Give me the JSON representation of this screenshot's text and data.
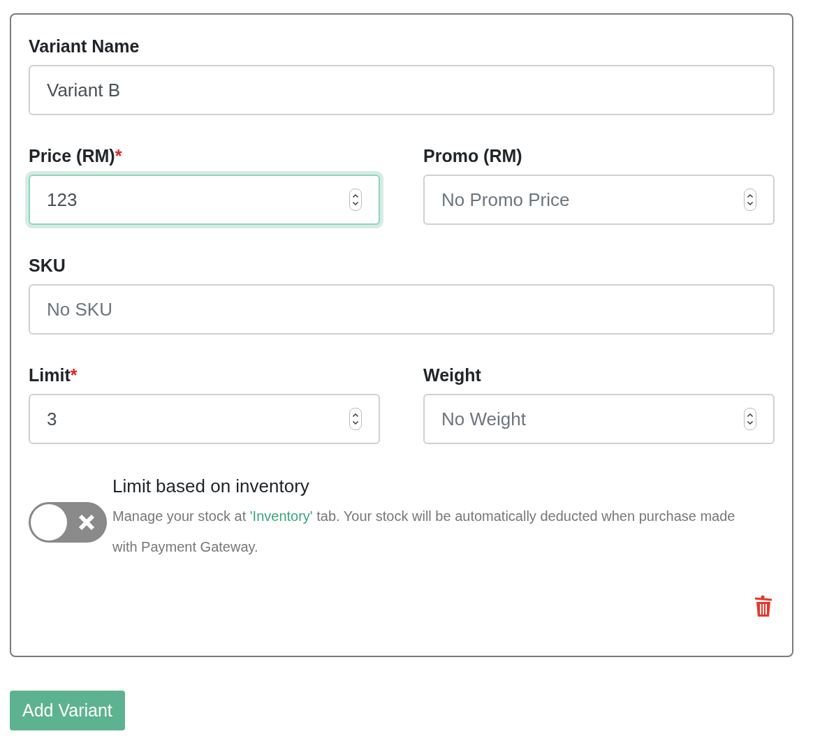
{
  "variant_card": {
    "rows": [
      [
        {
          "label": "Variant Name",
          "kind": "text",
          "value": "Variant B",
          "focused": false
        }
      ],
      [
        {
          "label": "Price (RM)",
          "required_mark": "*",
          "kind": "number",
          "value": "123",
          "focused": true
        },
        {
          "label": "Promo (RM)",
          "kind": "number",
          "placeholder": "No Promo Price",
          "focused": false
        }
      ],
      [
        {
          "label": "SKU",
          "kind": "text",
          "placeholder": "No SKU",
          "focused": false
        }
      ],
      [
        {
          "label": "Limit",
          "required_mark": "*",
          "kind": "number",
          "value": "3",
          "focused": false
        },
        {
          "label": "Weight",
          "kind": "number",
          "placeholder": "No Weight",
          "focused": false
        }
      ]
    ],
    "inventory_toggle": {
      "on": false,
      "title": "Limit based on inventory",
      "description_before": "Manage your stock at ",
      "description_link": "'Inventory'",
      "description_after": " tab. Your stock will be automatically deducted when purchase made with Payment Gateway."
    }
  },
  "add_button": "Add Variant"
}
